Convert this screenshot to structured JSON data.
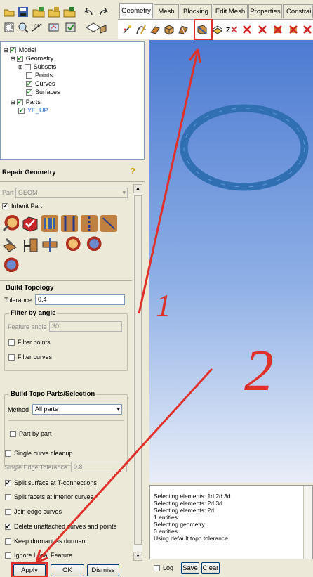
{
  "tabs": [
    {
      "label": "Geometry",
      "active": true
    },
    {
      "label": "Mesh",
      "active": false
    },
    {
      "label": "Blocking",
      "active": false
    },
    {
      "label": "Edit Mesh",
      "active": false
    },
    {
      "label": "Properties",
      "active": false
    },
    {
      "label": "Constrain",
      "active": false
    }
  ],
  "tree": {
    "model": "Model",
    "geometry": "Geometry",
    "subsets": "Subsets",
    "points": "Points",
    "curves": "Curves",
    "surfaces": "Surfaces",
    "parts": "Parts",
    "part_name": "YE_UP"
  },
  "panel": {
    "title": "Repair Geometry",
    "part_label": "Part",
    "part_value": "GEOM",
    "inherit_part": "Inherit Part",
    "build_topology": "Build Topology",
    "tolerance_label": "Tolerance",
    "tolerance_value": "0.4",
    "filter_by_angle": "Filter by angle",
    "feature_angle_label": "Feature angle",
    "feature_angle_value": "30",
    "filter_points": "Filter points",
    "filter_curves": "Filter curves",
    "build_topo_parts": "Build Topo Parts/Selection",
    "method_label": "Method",
    "method_value": "All parts",
    "part_by_part": "Part by part",
    "single_curve_cleanup": "Single curve cleanup",
    "single_edge_tolerance_label": "Single Edge Tolerance",
    "single_edge_tolerance_value": "0.8",
    "split_surface": "Split surface at T-connections",
    "split_facets": "Split facets at interior curves",
    "join_edge_curves": "Join edge curves",
    "delete_unattached": "Delete unattached curves and points",
    "keep_dormant": "Keep dormant as dormant",
    "ignore_local": "Ignore Local Feature"
  },
  "buttons": {
    "apply": "Apply",
    "ok": "OK",
    "dismiss": "Dismiss",
    "log": "Log",
    "save": "Save",
    "clear": "Clear"
  },
  "console_lines": [
    "Selecting elements: 1d 2d 3d",
    "Selecting elements: 2d 3d",
    "Selecting elements: 2d",
    "1 entities",
    "Selecting geometry.",
    "0 entities",
    "Using default topo tolerance"
  ],
  "annotations": {
    "label_1": "1",
    "label_2": "2"
  },
  "colors": {
    "annotation_red": "#e0302a",
    "ring_blue": "#2f6fb2",
    "part_blue": "#2a6fd8",
    "check_green": "#1a8b1a"
  }
}
